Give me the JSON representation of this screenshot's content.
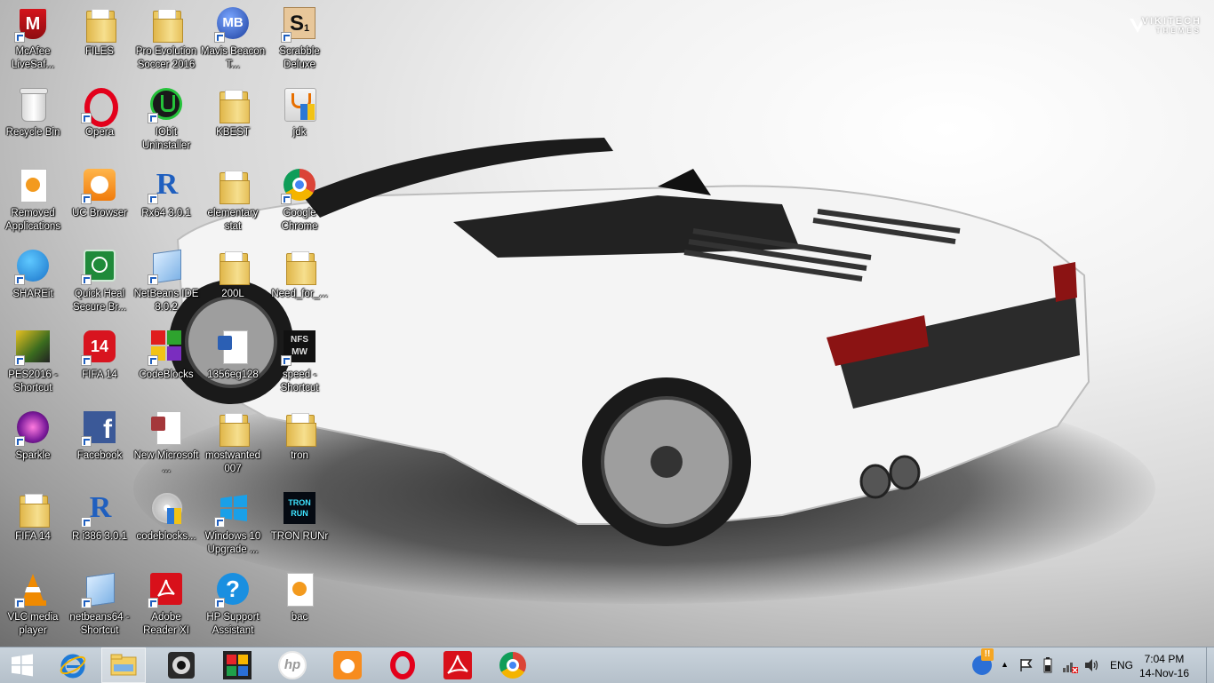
{
  "watermark": {
    "line1": "VIKITECH",
    "line2": "THEMES"
  },
  "icons": [
    {
      "label": "McAfee LiveSaf..."
    },
    {
      "label": "FILES"
    },
    {
      "label": "Pro Evolution Soccer 2016"
    },
    {
      "label": "Mavis Beacon T..."
    },
    {
      "label": "Scrabble Deluxe"
    },
    {
      "label": "Recycle Bin"
    },
    {
      "label": "Opera"
    },
    {
      "label": "IObit Uninstaller"
    },
    {
      "label": "KBEST"
    },
    {
      "label": "jdk"
    },
    {
      "label": "Removed Applications"
    },
    {
      "label": "UC Browser"
    },
    {
      "label": "Rx64 3.0.1"
    },
    {
      "label": "elementary stat"
    },
    {
      "label": "Google Chrome"
    },
    {
      "label": "SHAREit"
    },
    {
      "label": "Quick Heal Secure Br..."
    },
    {
      "label": "NetBeans IDE 8.0.2"
    },
    {
      "label": "200L"
    },
    {
      "label": "Need_for_..."
    },
    {
      "label": "PES2016 - Shortcut"
    },
    {
      "label": "FIFA 14"
    },
    {
      "label": "CodeBlocks"
    },
    {
      "label": "1356eg128"
    },
    {
      "label": "speed - Shortcut"
    },
    {
      "label": "Sparkle"
    },
    {
      "label": "Facebook"
    },
    {
      "label": "New Microsoft ..."
    },
    {
      "label": "mostwanted 007"
    },
    {
      "label": "tron"
    },
    {
      "label": "FIFA 14"
    },
    {
      "label": "R i386 3.0.1"
    },
    {
      "label": "codeblocks..."
    },
    {
      "label": "Windows 10 Upgrade ..."
    },
    {
      "label": "TRON RUNr"
    },
    {
      "label": "VLC media player"
    },
    {
      "label": "netbeans64 - Shortcut"
    },
    {
      "label": "Adobe Reader XI"
    },
    {
      "label": "HP Support Assistant"
    },
    {
      "label": "bac"
    }
  ],
  "icon_text": {
    "mcafee": "M",
    "mavis": "MB",
    "scrabble": "S",
    "scrabble_sub": "1",
    "r": "R",
    "fifa_badge": "14",
    "hp": "hp",
    "nfs": "NFS",
    "nfs_sub": "MW",
    "tron": "TRON",
    "tron_sub": "RUN",
    "facebook": "f",
    "help": "?"
  },
  "taskbar": {
    "tray_alert": "!!",
    "chevron": "▲",
    "language": "ENG",
    "time": "7:04 PM",
    "date": "14-Nov-16"
  },
  "colors": {
    "taskbar": "#b9c4ce",
    "ie_blue": "#1f7ad6",
    "opera_red": "#e3001b",
    "acrobat_red": "#d8101a"
  }
}
